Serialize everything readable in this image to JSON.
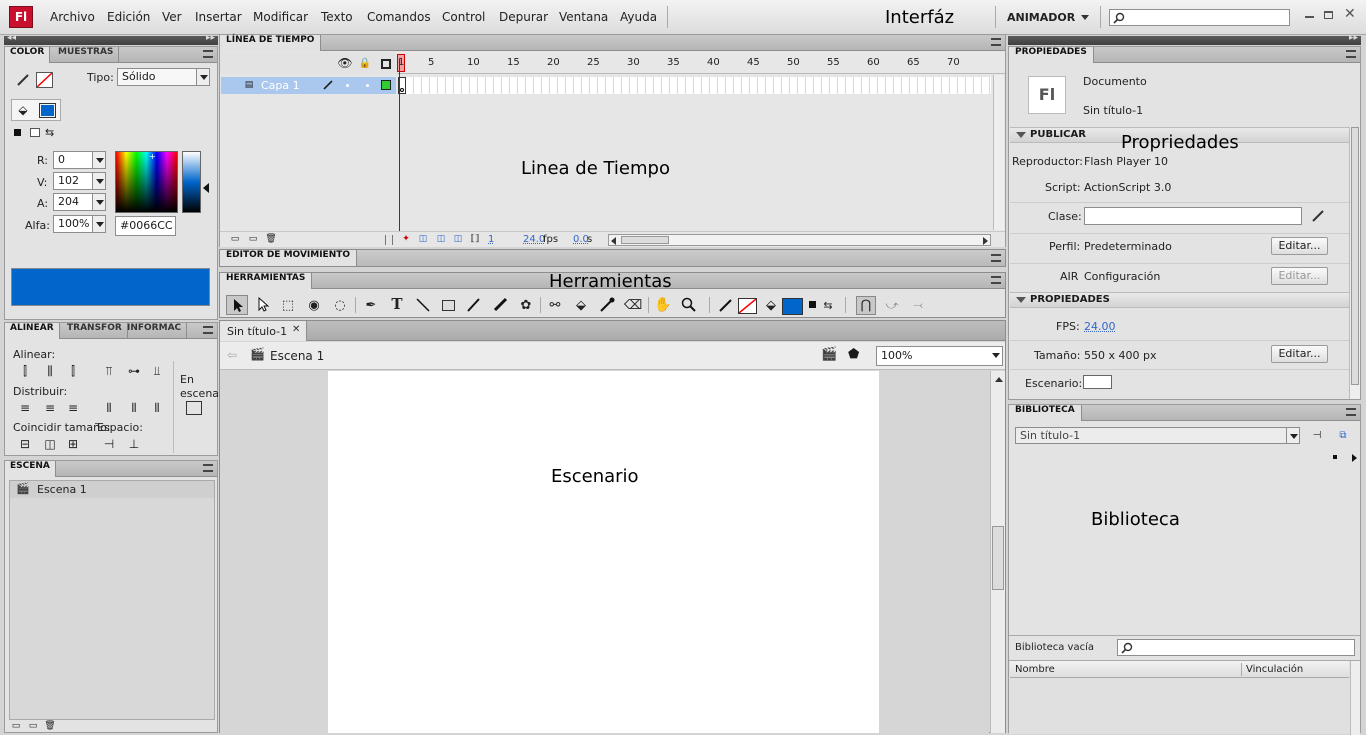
{
  "app": {
    "logo": "Fl",
    "workspace": "ANIMADOR",
    "search_placeholder": ""
  },
  "menu": [
    "Archivo",
    "Edición",
    "Ver",
    "Insertar",
    "Modificar",
    "Texto",
    "Comandos",
    "Control",
    "Depurar",
    "Ventana",
    "Ayuda"
  ],
  "annotations": {
    "interfaz": "Interfáz",
    "timeline": "Linea de Tiempo",
    "tools": "Herramientas",
    "stage": "Escenario",
    "properties": "Propriedades",
    "library": "Biblioteca"
  },
  "color_panel": {
    "tabs": [
      "COLOR",
      "MUESTRAS"
    ],
    "tipo_label": "Tipo:",
    "tipo_value": "Sólido",
    "r_label": "R:",
    "r": "0",
    "v_label": "V:",
    "v": "102",
    "a_label": "A:",
    "a": "204",
    "alfa_label": "Alfa:",
    "alfa": "100%",
    "hex": "#0066CC",
    "fill_color": "#0066CC"
  },
  "align_panel": {
    "tabs": [
      "ALINEAR",
      "TRANSFOR",
      "INFORMAC"
    ],
    "alinear": "Alinear:",
    "distribuir": "Distribuir:",
    "coincidir": "Coincidir tamaño:",
    "espacio": "Espacio:",
    "en_escena": "En escena"
  },
  "scene_panel": {
    "tab": "ESCENA",
    "items": [
      "Escena 1"
    ]
  },
  "timeline": {
    "tab": "LÍNEA DE TIEMPO",
    "frame_labels": [
      "1",
      "5",
      "10",
      "15",
      "20",
      "25",
      "30",
      "35",
      "40",
      "45",
      "50",
      "55",
      "60",
      "65",
      "70"
    ],
    "layer": "Capa 1",
    "current_frame": "1",
    "fps": "24.0",
    "fps_unit": "fps",
    "time": "0.0",
    "time_unit": "s"
  },
  "motion_editor": {
    "tab": "EDITOR DE MOVIMIENTO"
  },
  "tools": {
    "tab": "HERRAMIENTAS",
    "stroke_color": "#ff0000",
    "fill_color": "#0066CC"
  },
  "document": {
    "tab": "Sin título-1",
    "scene": "Escena 1",
    "zoom": "100%"
  },
  "properties": {
    "tab": "PROPIEDADES",
    "doc_type": "Documento",
    "doc_name": "Sin título-1",
    "icon_text": "Fl",
    "publish_section": "PUBLICAR",
    "reproductor_label": "Reproductor:",
    "reproductor": "Flash Player 10",
    "script_label": "Script:",
    "script": "ActionScript 3.0",
    "clase_label": "Clase:",
    "perfil_label": "Perfil:",
    "perfil": "Predeterminado",
    "air_label": "AIR",
    "air": "Configuración",
    "edit": "Editar...",
    "props_section": "PROPIEDADES",
    "fps_label": "FPS:",
    "fps": "24.00",
    "size_label": "Tamaño:",
    "size": "550 x 400 px",
    "stage_label": "Escenario:"
  },
  "library": {
    "tab": "BIBLIOTECA",
    "doc": "Sin título-1",
    "empty": "Biblioteca vacía",
    "col_name": "Nombre",
    "col_link": "Vinculación"
  }
}
